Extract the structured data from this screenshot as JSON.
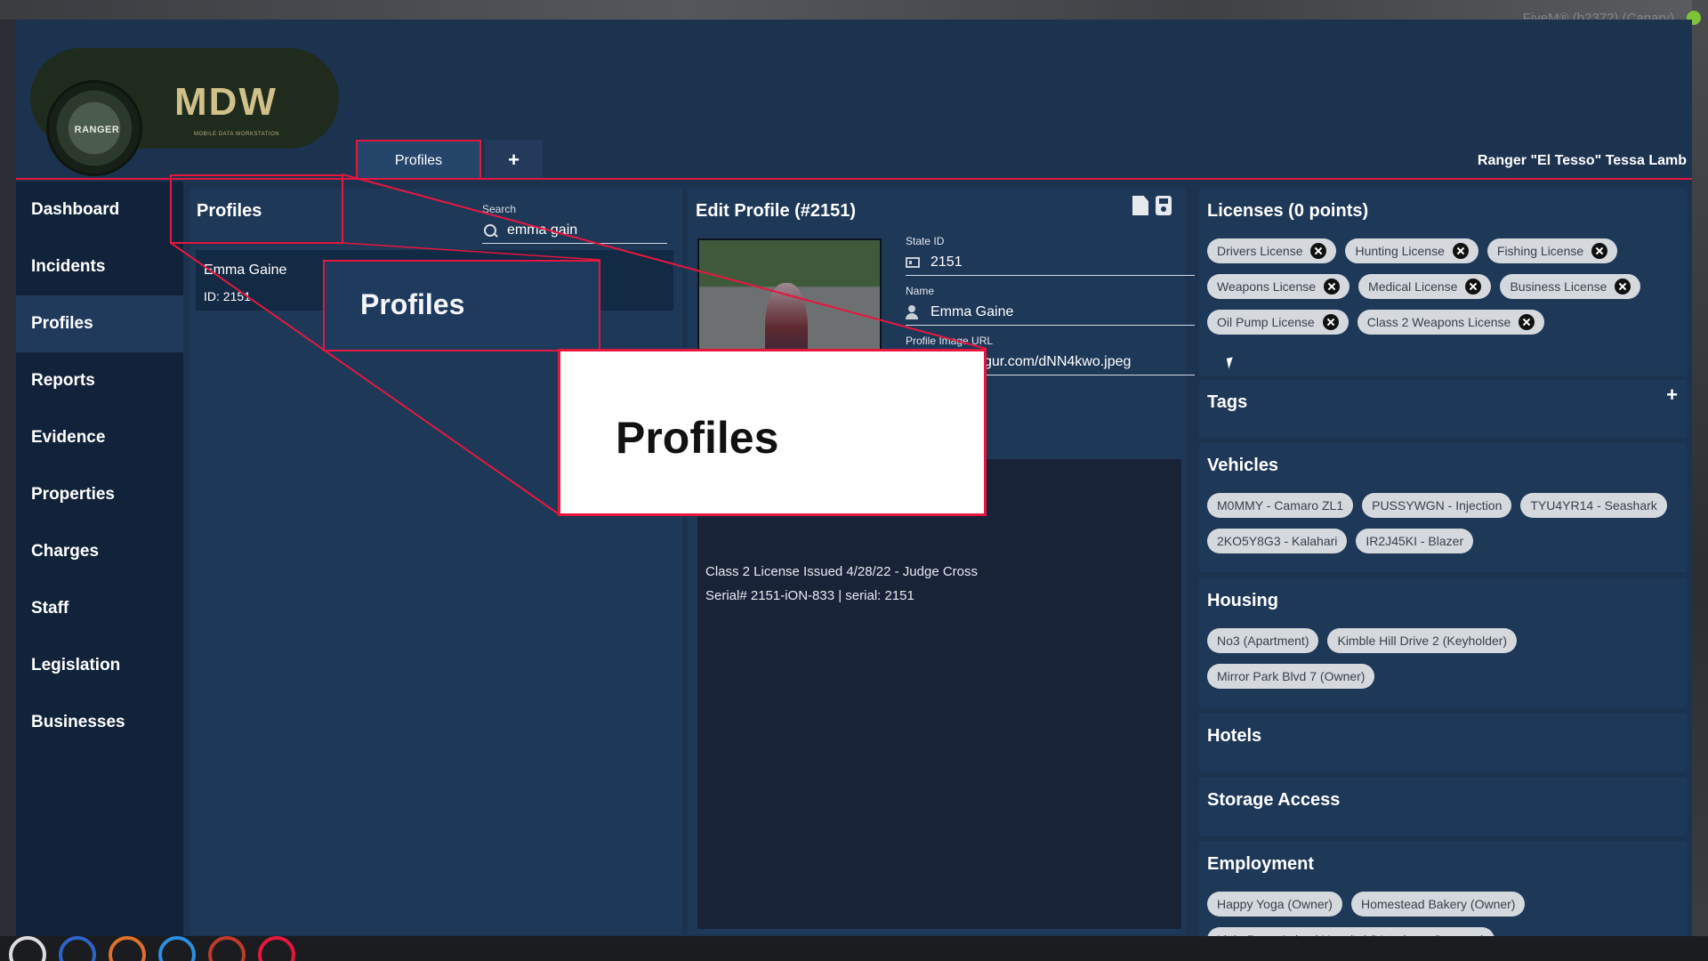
{
  "system": {
    "overlay_text": "FiveM® (b2372) (Canary)"
  },
  "logo": {
    "seal_text": "RANGER",
    "title": "MDW",
    "subtitle": "MOBILE DATA WORKSTATION"
  },
  "tabs": [
    {
      "label": "Profiles"
    },
    {
      "label": "+"
    }
  ],
  "user": {
    "name": "Ranger \"El Tesso\" Tessa Lamb"
  },
  "sidebar": {
    "items": [
      {
        "label": "Dashboard"
      },
      {
        "label": "Incidents"
      },
      {
        "label": "Profiles"
      },
      {
        "label": "Reports"
      },
      {
        "label": "Evidence"
      },
      {
        "label": "Properties"
      },
      {
        "label": "Charges"
      },
      {
        "label": "Staff"
      },
      {
        "label": "Legislation"
      },
      {
        "label": "Businesses"
      }
    ],
    "active": "Profiles"
  },
  "profiles_panel": {
    "title": "Profiles",
    "search": {
      "label": "Search",
      "value": "emma gain"
    },
    "results": [
      {
        "name": "Emma Gaine",
        "id": "ID: 2151"
      }
    ]
  },
  "edit_profile": {
    "title": "Edit Profile (#2151)",
    "state_id_label": "State ID",
    "state_id": "2151",
    "name_label": "Name",
    "name": "Emma Gaine",
    "image_label": "Profile Image URL",
    "image_url": "gur.com/dNN4kwo.jpeg",
    "notes": [
      "Class 2 License Issued 4/28/22 - Judge Cross",
      "Serial# 2151-iON-833 | serial: 2151"
    ]
  },
  "licenses": {
    "title": "Licenses (0 points)",
    "items": [
      "Drivers License",
      "Hunting License",
      "Fishing License",
      "Weapons License",
      "Medical License",
      "Business License",
      "Oil Pump License",
      "Class 2 Weapons License"
    ]
  },
  "tags": {
    "title": "Tags",
    "add_label": "+"
  },
  "vehicles": {
    "title": "Vehicles",
    "items": [
      "M0MMY - Camaro ZL1",
      "PUSSYWGN - Injection",
      "TYU4YR14 - Seashark",
      "2KO5Y8G3 - Kalahari",
      "IR2J45KI - Blazer"
    ]
  },
  "housing": {
    "title": "Housing",
    "items": [
      "No3 (Apartment)",
      "Kimble Hill Drive 2 (Keyholder)",
      "Mirror Park Blvd 7 (Owner)"
    ]
  },
  "hotels": {
    "title": "Hotels"
  },
  "storage": {
    "title": "Storage Access"
  },
  "employment": {
    "title": "Employment",
    "items": [
      "Happy Yoga (Owner)",
      "Homestead Bakery (Owner)",
      "Little Paws Animal Hospital (Veterinary Surgeon)"
    ]
  },
  "annotation": {
    "zoom_small": "Profiles",
    "zoom_large": "Profiles"
  },
  "colors": {
    "accent": "#e5173f",
    "panel": "#1e3858",
    "sidebar": "#11233a",
    "chip": "#d5d9de"
  }
}
